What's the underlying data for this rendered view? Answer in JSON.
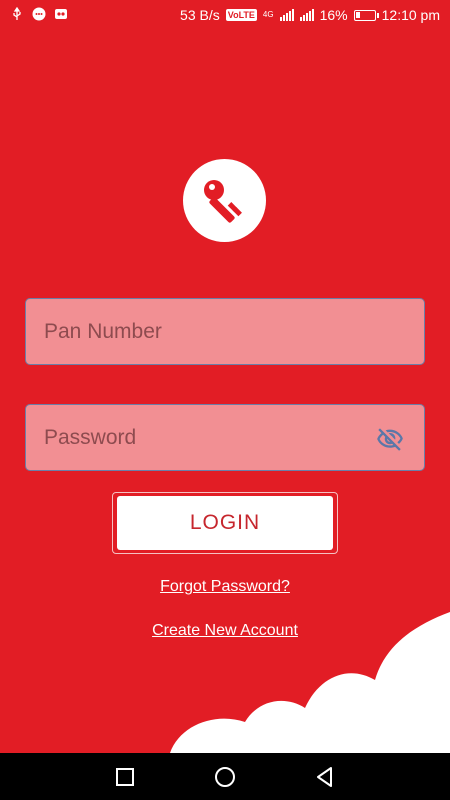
{
  "status_bar": {
    "speed": "53 B/s",
    "volte": "VoLTE",
    "network": "4G",
    "battery": "16%",
    "time": "12:10 pm"
  },
  "icons": {
    "usb": "usb-icon",
    "chat": "chat-icon",
    "notification": "app-notification-icon",
    "logo": "key-icon",
    "eye": "eye-off-icon",
    "recent": "square-icon",
    "home": "circle-icon",
    "back": "triangle-back-icon"
  },
  "form": {
    "pan_placeholder": "Pan Number",
    "password_placeholder": "Password",
    "login_label": "LOGIN",
    "forgot_label": "Forgot Password?",
    "create_label": "Create New Account"
  },
  "colors": {
    "background": "#e21d25",
    "field_fill": "#f28f93",
    "button_text": "#c6262d"
  }
}
